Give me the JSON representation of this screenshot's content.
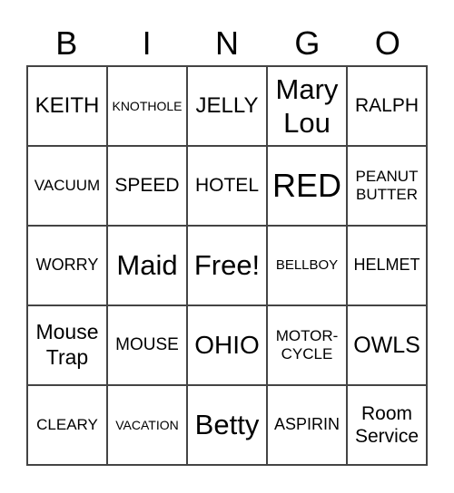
{
  "header": [
    "B",
    "I",
    "N",
    "G",
    "O"
  ],
  "cells": [
    "KEITH",
    "KNOTHOLE",
    "JELLY",
    "Mary Lou",
    "RALPH",
    "VACUUM",
    "SPEED",
    "HOTEL",
    "RED",
    "PEANUT BUTTER",
    "WORRY",
    "Maid",
    "Free!",
    "BELLBOY",
    "HELMET",
    "Mouse Trap",
    "MOUSE",
    "OHIO",
    "MOTOR-CYCLE",
    "OWLS",
    "CLEARY",
    "VACATION",
    "Betty",
    "ASPIRIN",
    "Room Service"
  ]
}
